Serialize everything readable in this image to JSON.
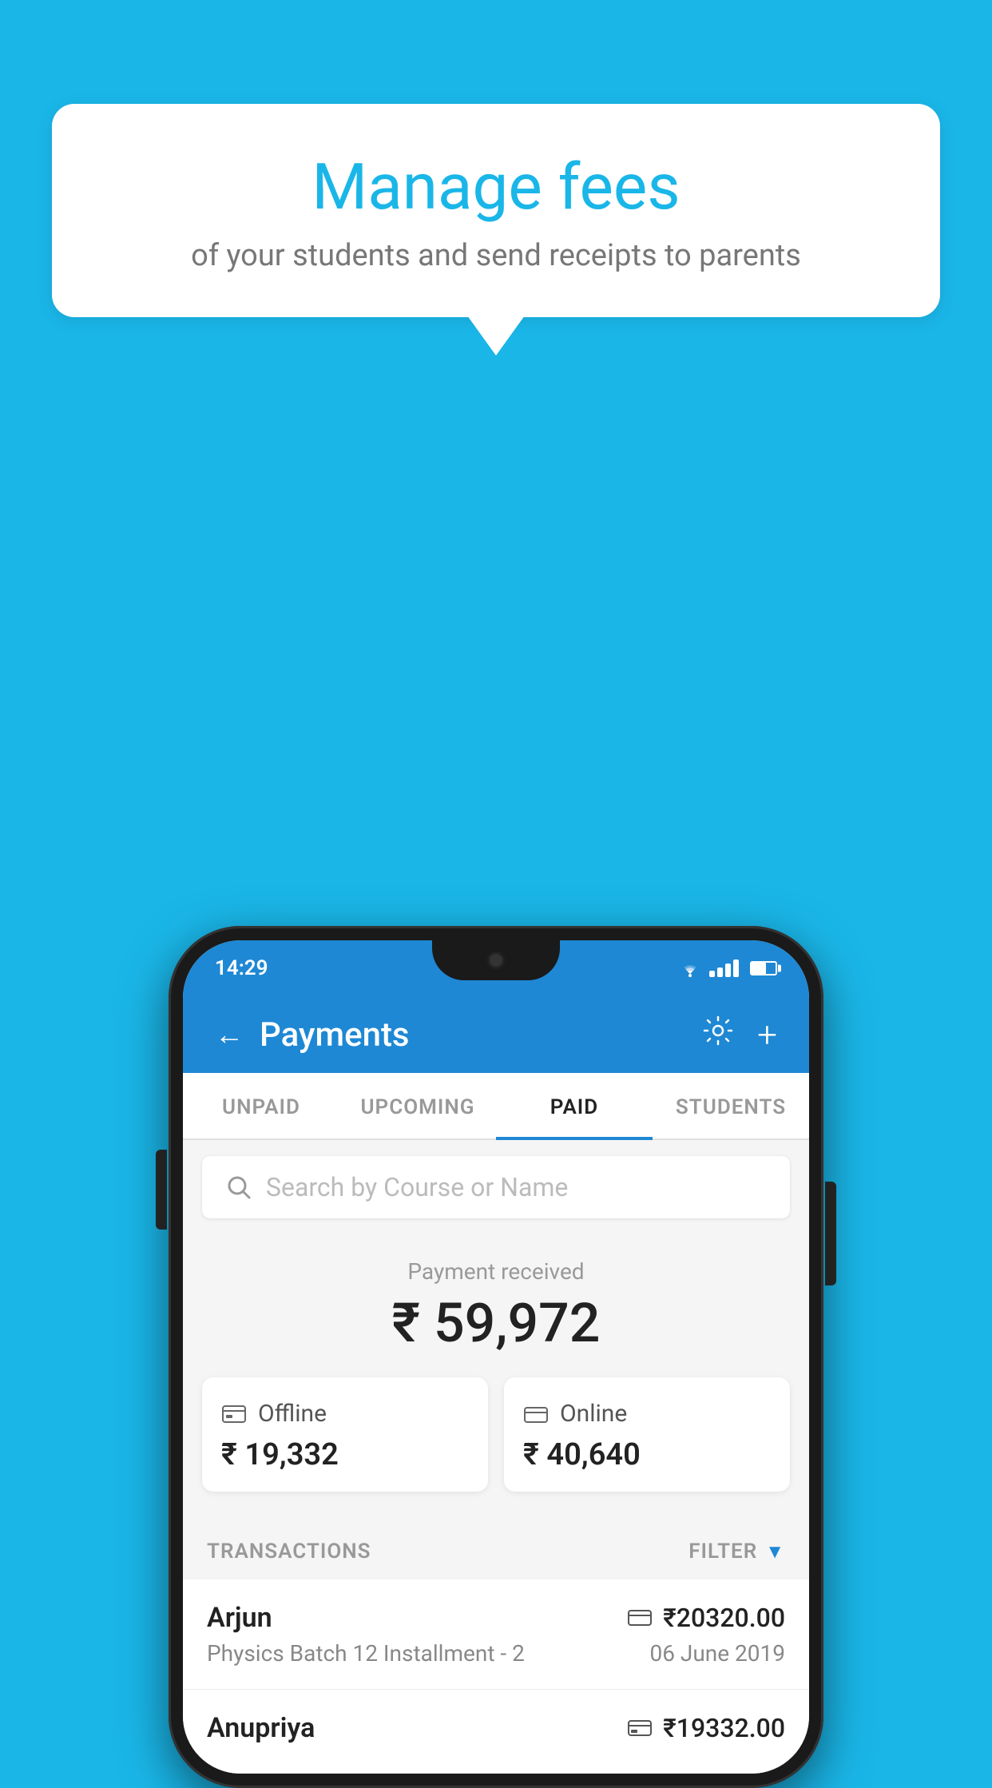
{
  "background_color": "#1ab6e8",
  "speech_bubble": {
    "title": "Manage fees",
    "subtitle": "of your students and send receipts to parents"
  },
  "status_bar": {
    "time": "14:29"
  },
  "header": {
    "title": "Payments",
    "back_label": "←",
    "plus_label": "+"
  },
  "tabs": [
    {
      "label": "UNPAID",
      "active": false
    },
    {
      "label": "UPCOMING",
      "active": false
    },
    {
      "label": "PAID",
      "active": true
    },
    {
      "label": "STUDENTS",
      "active": false
    }
  ],
  "search": {
    "placeholder": "Search by Course or Name"
  },
  "payment_summary": {
    "received_label": "Payment received",
    "total_amount": "₹ 59,972",
    "offline_label": "Offline",
    "offline_amount": "₹ 19,332",
    "online_label": "Online",
    "online_amount": "₹ 40,640"
  },
  "transactions": {
    "header_label": "TRANSACTIONS",
    "filter_label": "FILTER",
    "rows": [
      {
        "name": "Arjun",
        "course": "Physics Batch 12 Installment - 2",
        "amount": "₹20320.00",
        "date": "06 June 2019",
        "payment_type": "online"
      },
      {
        "name": "Anupriya",
        "course": "",
        "amount": "₹19332.00",
        "date": "",
        "payment_type": "offline"
      }
    ]
  }
}
